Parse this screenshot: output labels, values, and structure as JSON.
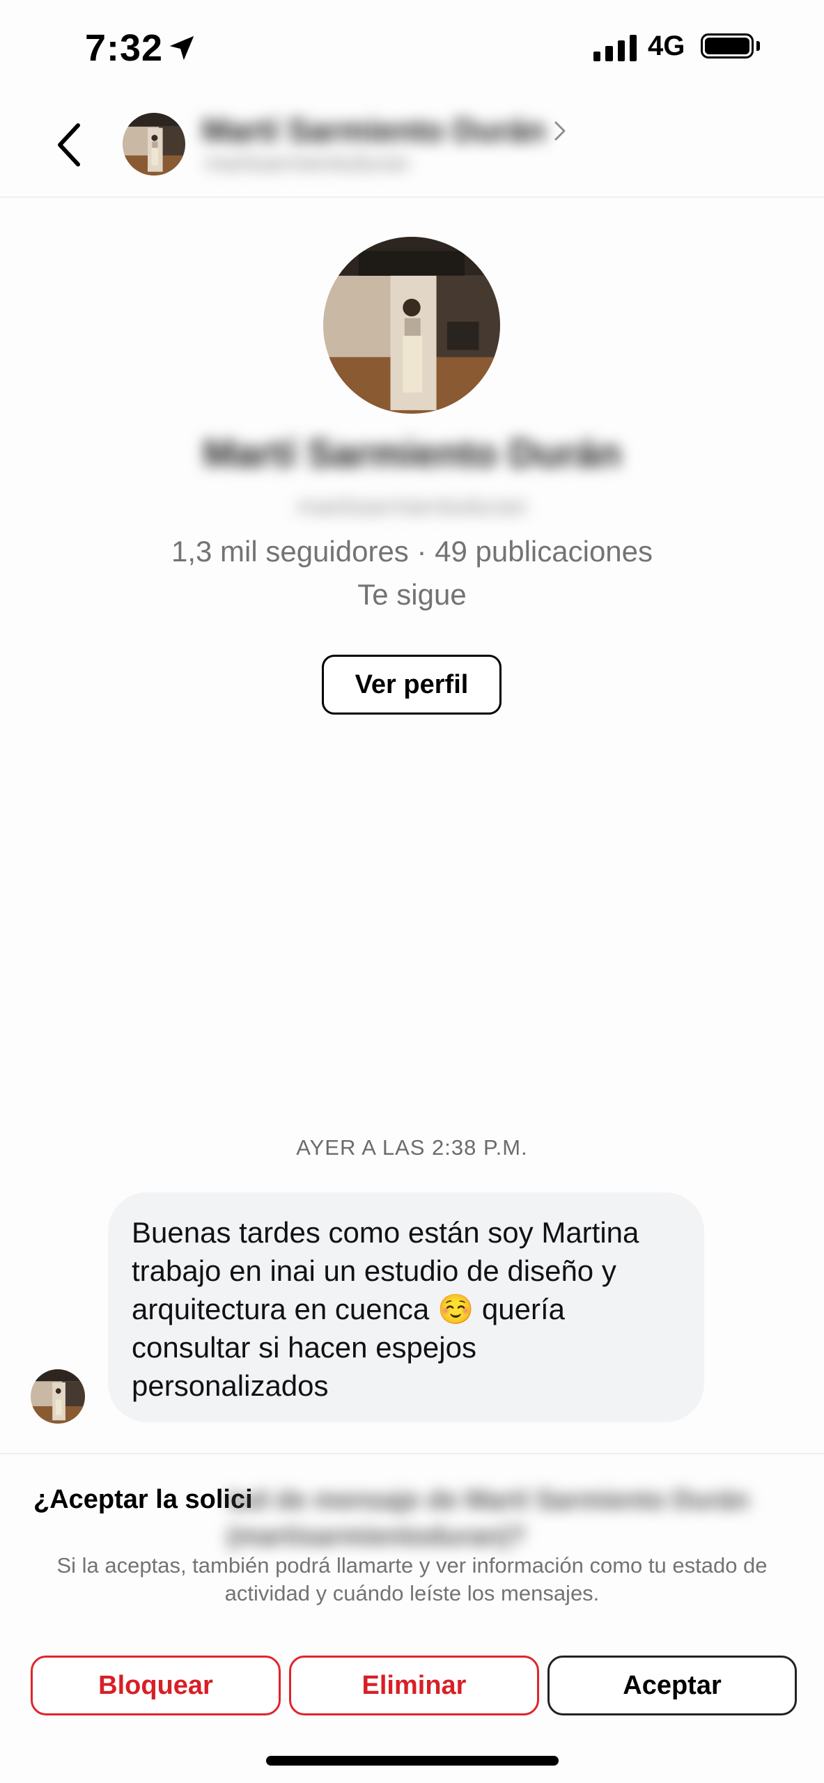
{
  "status_bar": {
    "time": "7:32",
    "network": "4G",
    "location_icon": "location-arrow-icon",
    "signal_icon": "signal-bars-icon",
    "battery_icon": "battery-full-icon"
  },
  "header": {
    "back_icon": "chevron-left-icon",
    "contact_name": "Martí Sarmiento Durán",
    "contact_username": "martisarmientoduran",
    "forward_icon": "chevron-right-icon"
  },
  "profile": {
    "name": "Martí Sarmiento Durán",
    "username": "martisarmientoduran",
    "stats": "1,3 mil seguidores · 49 publicaciones",
    "follows_you": "Te sigue",
    "view_profile_label": "Ver perfil"
  },
  "conversation": {
    "timestamp": "AYER A LAS 2:38 P.M.",
    "message": "Buenas tardes como están soy Martina trabajo en inai un estudio de diseño y arquitectura en cuenca ☺️ quería consultar si hacen espejos personalizados"
  },
  "request": {
    "title_visible": "¿Aceptar la solici",
    "title_blurred": "tud de mensaje de Martí Sarmiento Durán (martisarmientoduran)?",
    "description": "Si la aceptas, también podrá llamarte y ver información como tu estado de actividad y cuándo leíste los mensajes.",
    "buttons": {
      "block": "Bloquear",
      "delete": "Eliminar",
      "accept": "Aceptar"
    }
  },
  "colors": {
    "danger": "#d81f26",
    "bubble": "#f2f3f5",
    "muted": "#737373"
  }
}
